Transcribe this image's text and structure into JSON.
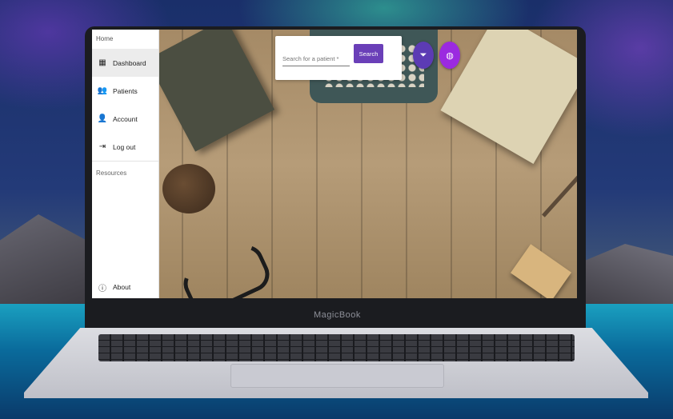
{
  "device": {
    "brand_label": "MagicBook"
  },
  "sidebar": {
    "header": "Home",
    "items": [
      {
        "label": "Dashboard",
        "icon": "dashboard-icon"
      },
      {
        "label": "Patients",
        "icon": "people-icon"
      },
      {
        "label": "Account",
        "icon": "person-icon"
      },
      {
        "label": "Log out",
        "icon": "logout-icon"
      }
    ],
    "subheader": "Resources",
    "about": {
      "label": "About",
      "icon": "info-icon"
    }
  },
  "search": {
    "placeholder": "Search for a patient *",
    "button_label": "Search"
  },
  "fabs": [
    {
      "icon": "filter-icon"
    },
    {
      "icon": "account-circle-icon"
    }
  ],
  "colors": {
    "primary": "#6a3fb8",
    "fab_filter": "#5c3bb4",
    "fab_account": "#9b2ae0"
  }
}
